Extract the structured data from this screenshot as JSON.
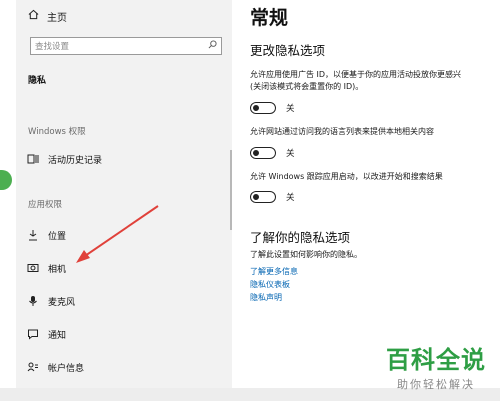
{
  "sidebar": {
    "home_label": "主页",
    "search_placeholder": "查找设置",
    "section_title": "隐私",
    "windows_group": "Windows 权限",
    "activity_history": "活动历史记录",
    "app_group": "应用权限",
    "items": [
      {
        "label": "位置",
        "icon": "location-icon"
      },
      {
        "label": "相机",
        "icon": "camera-icon"
      },
      {
        "label": "麦克风",
        "icon": "microphone-icon"
      },
      {
        "label": "通知",
        "icon": "notification-icon"
      },
      {
        "label": "帐户信息",
        "icon": "account-info-icon"
      }
    ]
  },
  "main": {
    "title": "常规",
    "change_heading": "更改隐私选项",
    "options": [
      {
        "line1": "允许应用使用广告 ID，以便基于你的应用活动投放你更感兴",
        "line2": "(关闭该模式将会重置你的 ID)。",
        "state": "关"
      },
      {
        "line1": "允许网站通过访问我的语言列表来提供本地相关内容",
        "line2": "",
        "state": "关"
      },
      {
        "line1": "允许 Windows 跟踪应用启动，以改进开始和搜索结果",
        "line2": "",
        "state": "关"
      }
    ],
    "learn_heading": "了解你的隐私选项",
    "learn_desc": "了解此设置如何影响你的隐私。",
    "links": [
      "了解更多信息",
      "隐私仪表板",
      "隐私声明"
    ]
  },
  "watermark": {
    "main": "百科全说",
    "sub": "助你轻松解决"
  },
  "colors": {
    "accent_link": "#0063b1",
    "arrow": "#e0413a",
    "watermark": "#2e9e44"
  }
}
